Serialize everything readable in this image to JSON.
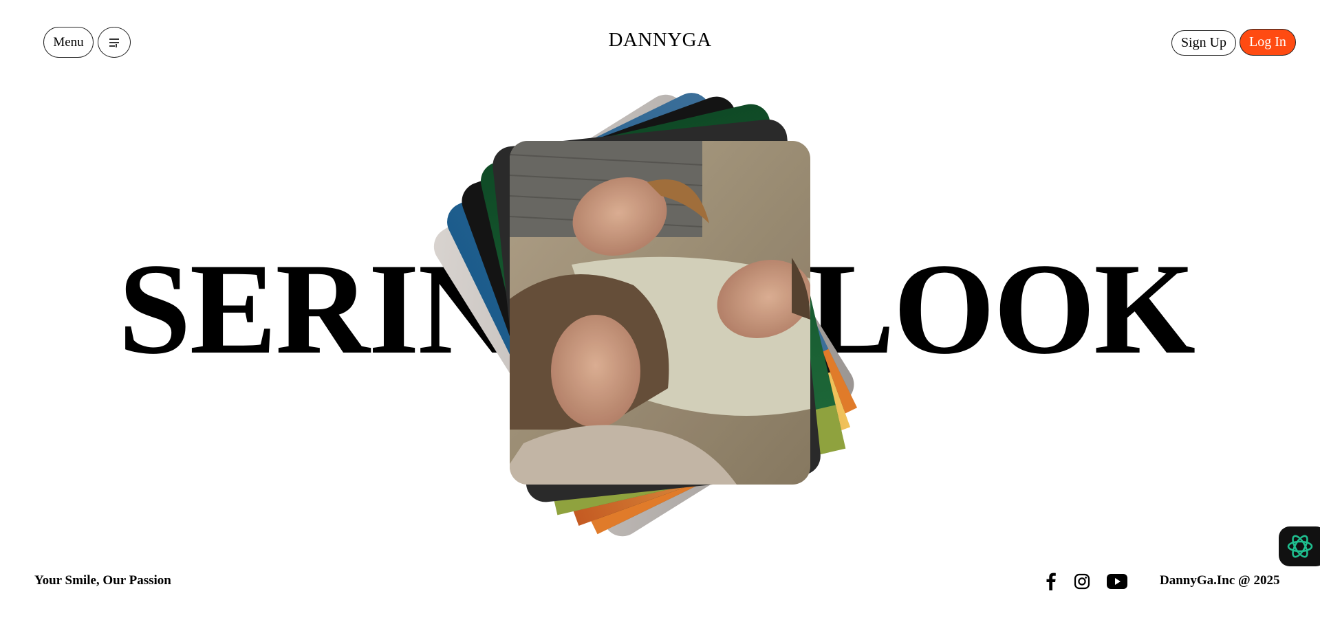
{
  "header": {
    "menu_label": "Menu",
    "filter_icon": "sliders-icon",
    "brand": "DANNYGA",
    "signup_label": "Sign Up",
    "login_label": "Log In"
  },
  "hero": {
    "word_left": "SERIN",
    "word_right": "LOOK"
  },
  "footer": {
    "tagline": "Your Smile, Our Passion",
    "copyright": "DannyGa.Inc @ 2025",
    "social_icons": [
      "facebook-icon",
      "instagram-icon",
      "youtube-icon"
    ]
  },
  "floating_button_icon": "ai-assistant-icon",
  "colors": {
    "accent": "#ff4b12",
    "text": "#000000",
    "background": "#ffffff",
    "fab_icon": "#1fbf8f"
  }
}
